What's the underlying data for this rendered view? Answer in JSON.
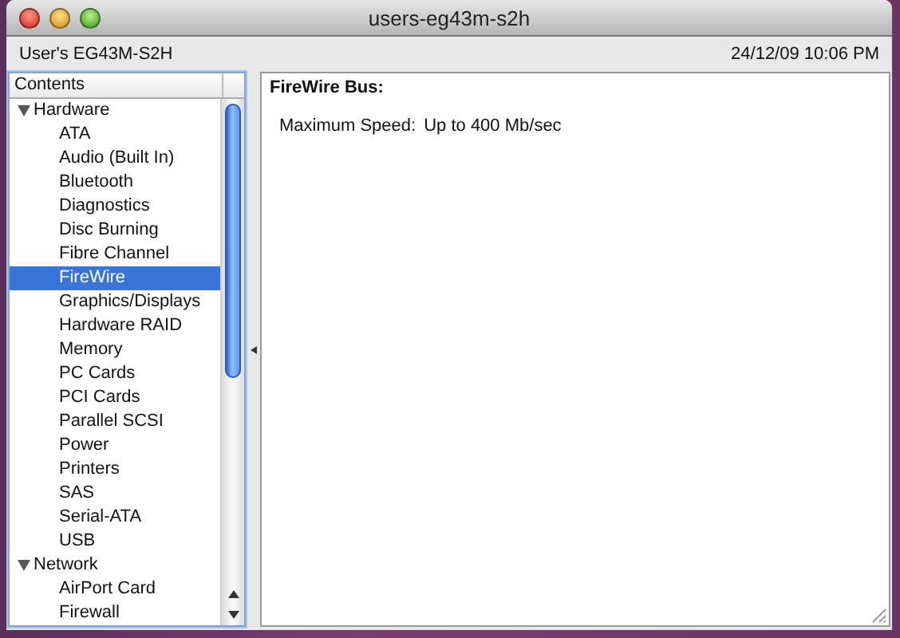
{
  "window": {
    "title": "users-eg43m-s2h"
  },
  "toolbar": {
    "computer_name": "User's EG43M-S2H",
    "timestamp": "24/12/09 10:06 PM"
  },
  "sidebar": {
    "header": "Contents",
    "items": [
      {
        "label": "Hardware",
        "expanded": true,
        "selected": false,
        "children": [
          {
            "label": "ATA",
            "selected": false
          },
          {
            "label": "Audio (Built In)",
            "selected": false
          },
          {
            "label": "Bluetooth",
            "selected": false
          },
          {
            "label": "Diagnostics",
            "selected": false
          },
          {
            "label": "Disc Burning",
            "selected": false
          },
          {
            "label": "Fibre Channel",
            "selected": false
          },
          {
            "label": "FireWire",
            "selected": true
          },
          {
            "label": "Graphics/Displays",
            "selected": false
          },
          {
            "label": "Hardware RAID",
            "selected": false
          },
          {
            "label": "Memory",
            "selected": false
          },
          {
            "label": "PC Cards",
            "selected": false
          },
          {
            "label": "PCI Cards",
            "selected": false
          },
          {
            "label": "Parallel SCSI",
            "selected": false
          },
          {
            "label": "Power",
            "selected": false
          },
          {
            "label": "Printers",
            "selected": false
          },
          {
            "label": "SAS",
            "selected": false
          },
          {
            "label": "Serial-ATA",
            "selected": false
          },
          {
            "label": "USB",
            "selected": false
          }
        ]
      },
      {
        "label": "Network",
        "expanded": true,
        "selected": false,
        "children": [
          {
            "label": "AirPort Card",
            "selected": false
          },
          {
            "label": "Firewall",
            "selected": false
          }
        ]
      }
    ]
  },
  "detail": {
    "heading": "FireWire Bus:",
    "fields": [
      {
        "label": "Maximum Speed:",
        "value": "Up to 400 Mb/sec"
      }
    ]
  }
}
